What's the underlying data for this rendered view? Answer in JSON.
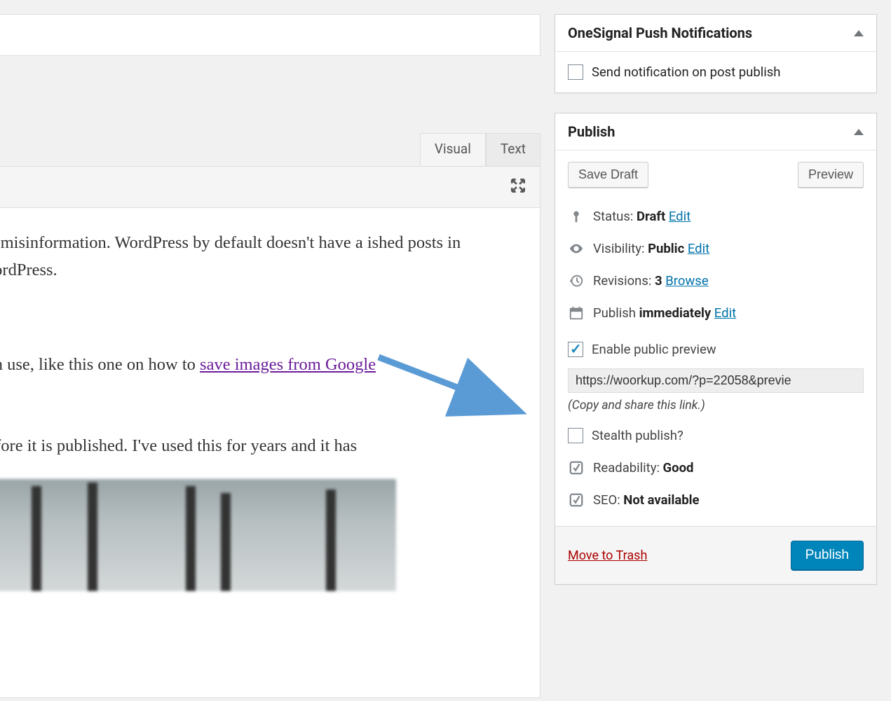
{
  "editor": {
    "tabs": {
      "visual": "Visual",
      "text": "Text"
    },
    "content": {
      "p1": "ny misinformation. WordPress by default doesn't have a ished posts in WordPress.",
      "p2_prefix": " can use, like this one on how to ",
      "p2_link": " save images from Google ",
      "p3": "before it is published. I've used this for years and it has"
    }
  },
  "metabox": {
    "onesignal": {
      "title": "OneSignal Push Notifications",
      "label": "Send notification on post publish"
    },
    "publish": {
      "title": "Publish",
      "save_draft": "Save Draft",
      "preview": "Preview",
      "status_label": "Status: ",
      "status_value": "Draft",
      "visibility_label": "Visibility: ",
      "visibility_value": "Public",
      "revisions_label": "Revisions: ",
      "revisions_value": "3",
      "browse": "Browse",
      "publish_label": "Publish ",
      "publish_value": "immediately",
      "edit": "Edit",
      "enable_preview": "Enable public preview",
      "preview_url": "https://woorkup.com/?p=22058&previe",
      "copy_hint": "(Copy and share this link.)",
      "stealth": "Stealth publish?",
      "readability_label": "Readability: ",
      "readability_value": "Good",
      "seo_label": "SEO: ",
      "seo_value": "Not available",
      "trash": "Move to Trash",
      "publish_button": "Publish"
    }
  }
}
